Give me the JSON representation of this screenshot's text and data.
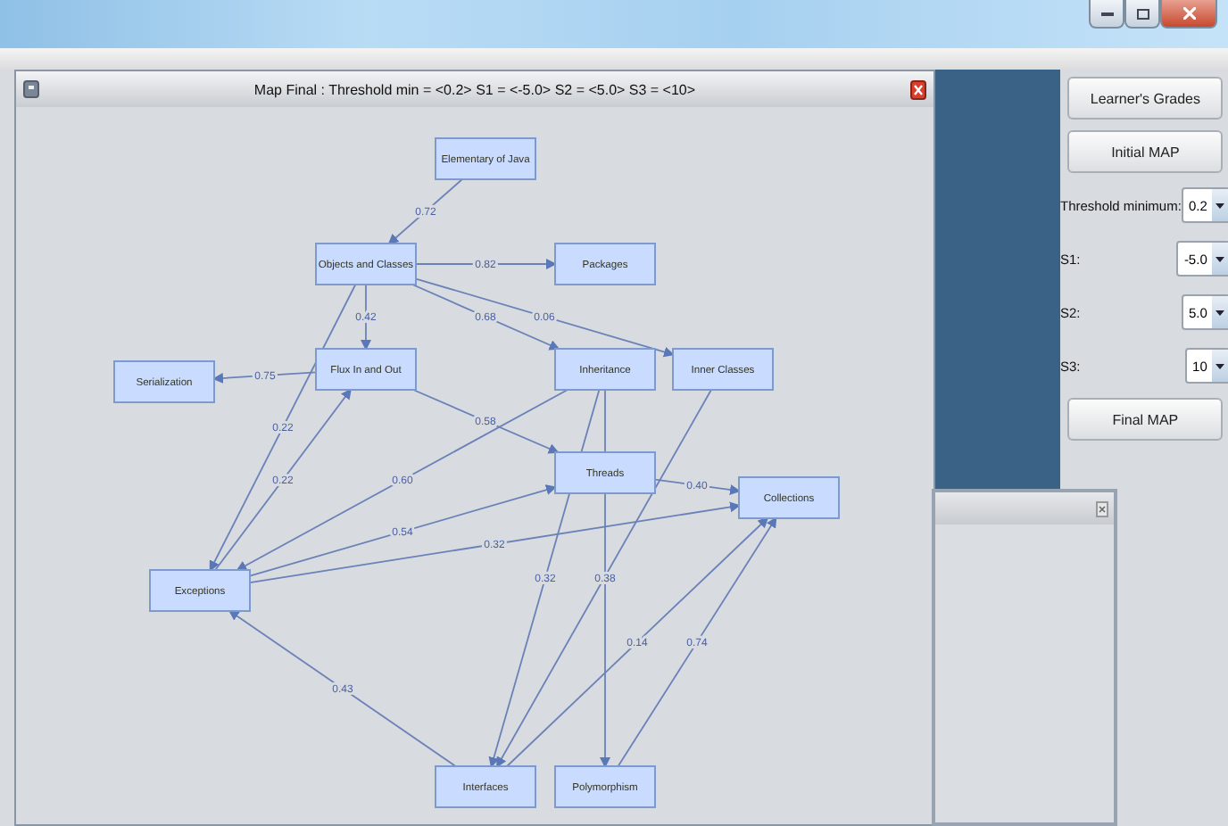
{
  "frame": {
    "title": "Map Final : Threshold min = <0.2> S1 = <-5.0> S2 = <5.0> S3 = <10>"
  },
  "map": {
    "nodes": [
      "Elementary of Java",
      "Objects and Classes",
      "Packages",
      "Flux In and Out",
      "Serialization",
      "Inheritance",
      "Inner Classes",
      "Threads",
      "Collections",
      "Exceptions",
      "Interfaces",
      "Polymorphism"
    ],
    "edge_labels": [
      "0.72",
      "0.82",
      "0.42",
      "0.68",
      "0.06",
      "0.75",
      "0.22",
      "0.22",
      "0.58",
      "0.60",
      "0.54",
      "0.32",
      "0.40",
      "0.32",
      "0.38",
      "0.14",
      "0.74",
      "0.43"
    ]
  },
  "panel": {
    "buttons_top": [
      "Learner's Grades",
      "Initial MAP"
    ],
    "settings": [
      {
        "label": "Threshold minimum:",
        "value": "0.2"
      },
      {
        "label": "S1:",
        "value": "-5.0"
      },
      {
        "label": "S2:",
        "value": "5.0"
      },
      {
        "label": "S3:",
        "value": "10"
      }
    ],
    "button_bottom": "Final MAP"
  }
}
